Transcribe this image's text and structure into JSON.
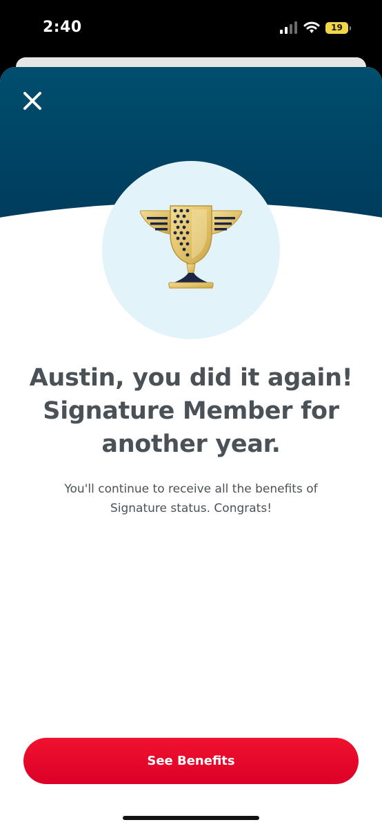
{
  "status_bar": {
    "time": "2:40",
    "battery": "19",
    "icons": [
      "cellular-signal-icon",
      "wifi-icon",
      "battery-icon"
    ]
  },
  "modal": {
    "close_icon": "close-icon",
    "badge_icon": "trophy-icon",
    "headline": {
      "line1": "Austin, you did it again!",
      "line2": "Signature Member for",
      "line3": "another year."
    },
    "subtext": {
      "line1": "You'll continue to receive all the benefits of",
      "line2": "Signature status. Congrats!"
    },
    "primary_button_label": "See Benefits"
  },
  "colors": {
    "header_background": "#004e6e",
    "badge_circle": "#e3f3fa",
    "trophy_gold": "#e5c96f",
    "trophy_navy": "#1c2545",
    "text": "#4a5257",
    "button": "#e8072c"
  }
}
